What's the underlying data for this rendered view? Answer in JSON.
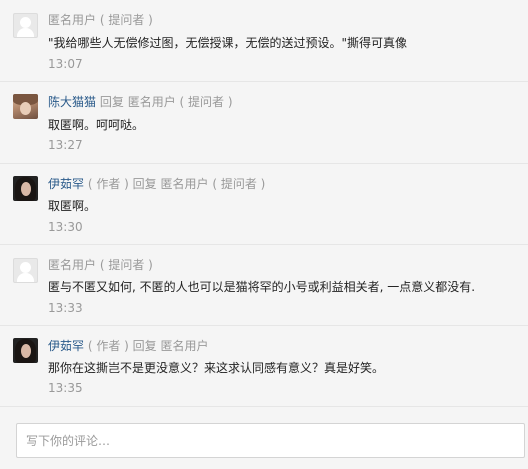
{
  "comments": [
    {
      "avatar": "anonymous-user-icon",
      "author": "匿名用户",
      "author_tag": "( 提问者 )",
      "text": "\"我给哪些人无偿修过图，无偿授课，无偿的送过预设。\"撕得可真像",
      "time": "13:07"
    },
    {
      "avatar": "cat-avatar",
      "author": "陈大猫猫",
      "reply_word": "回复",
      "reply_to": "匿名用户",
      "reply_to_tag": "( 提问者 )",
      "text": "取匿啊。呵呵哒。",
      "time": "13:27"
    },
    {
      "avatar": "girl-avatar",
      "author": "伊茹罕",
      "author_tag": "( 作者 )",
      "reply_word": "回复",
      "reply_to": "匿名用户",
      "reply_to_tag": "( 提问者 )",
      "text": "取匿啊。",
      "time": "13:30"
    },
    {
      "avatar": "anonymous-user-icon",
      "author": "匿名用户",
      "author_tag": "( 提问者 )",
      "text": "匿与不匿又如何, 不匿的人也可以是猫将罕的小号或利益相关者, 一点意义都没有.",
      "time": "13:33"
    },
    {
      "avatar": "girl-avatar",
      "author": "伊茹罕",
      "author_tag": "( 作者 )",
      "reply_word": "回复",
      "reply_to": "匿名用户",
      "text": "那你在这撕岂不是更没意义？来这求认同感有意义？真是好笑。",
      "time": "13:35"
    }
  ],
  "composer": {
    "placeholder": "写下你的评论…"
  }
}
